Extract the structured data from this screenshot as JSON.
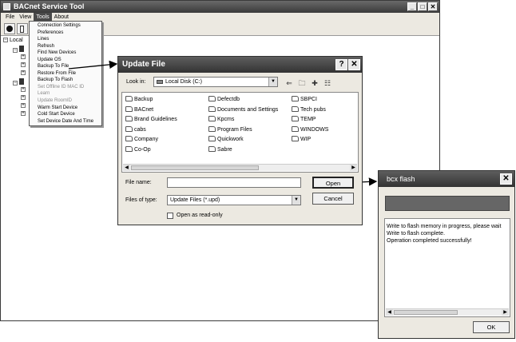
{
  "main_window": {
    "title": "BACnet Service Tool",
    "controls": [
      "_",
      "□",
      "✕"
    ],
    "menu": [
      "File",
      "View",
      "Tools",
      "About"
    ],
    "tree_root_label": "Local",
    "tools_menu": [
      {
        "label": "Connection Settings",
        "disabled": false
      },
      {
        "label": "Preferences",
        "disabled": false
      },
      {
        "label": "Lines",
        "disabled": false
      },
      {
        "label": "Refresh",
        "disabled": false
      },
      {
        "label": "Find New Devices",
        "disabled": false
      },
      {
        "label": "Update OS",
        "disabled": false
      },
      {
        "label": "Backup To File",
        "disabled": false
      },
      {
        "label": "Restore From File",
        "disabled": false
      },
      {
        "label": "Backup To Flash",
        "disabled": false
      },
      {
        "label": "Set Offline ID MAC ID",
        "disabled": true
      },
      {
        "label": "Learn",
        "disabled": true
      },
      {
        "label": "Update RoomID",
        "disabled": true
      },
      {
        "label": "Warm Start Device",
        "disabled": false
      },
      {
        "label": "Cold Start Device",
        "disabled": false
      },
      {
        "label": "Set Device Date And Time",
        "disabled": false
      }
    ]
  },
  "update_dialog": {
    "title": "Update File",
    "help": "?",
    "close": "✕",
    "look_in_label": "Look in:",
    "look_in_value": "Local Disk (C:)",
    "folders": [
      [
        "Backup",
        "BACnet",
        "Brand Guidelines",
        "cabs",
        "Company",
        "Co-Op"
      ],
      [
        "Defectdb",
        "Documents and Settings",
        "Kpcms",
        "Program Files",
        "Quickwork",
        "Sabre"
      ],
      [
        "SBPCI",
        "Tech pubs",
        "TEMP",
        "WINDOWS",
        "WIP"
      ]
    ],
    "file_name_label": "File name:",
    "file_name_value": "",
    "file_type_label": "Files of type:",
    "file_type_value": "Update Files (*.upd)",
    "open_button": "Open",
    "cancel_button": "Cancel",
    "readonly_label": "Open as read-only"
  },
  "flash_dialog": {
    "title": "bcx flash",
    "close": "✕",
    "progress": 1.0,
    "log": [
      "Write to flash memory in progress, please wait",
      "Write to flash complete.",
      "Operation completed successfully!"
    ],
    "ok_button": "OK"
  }
}
